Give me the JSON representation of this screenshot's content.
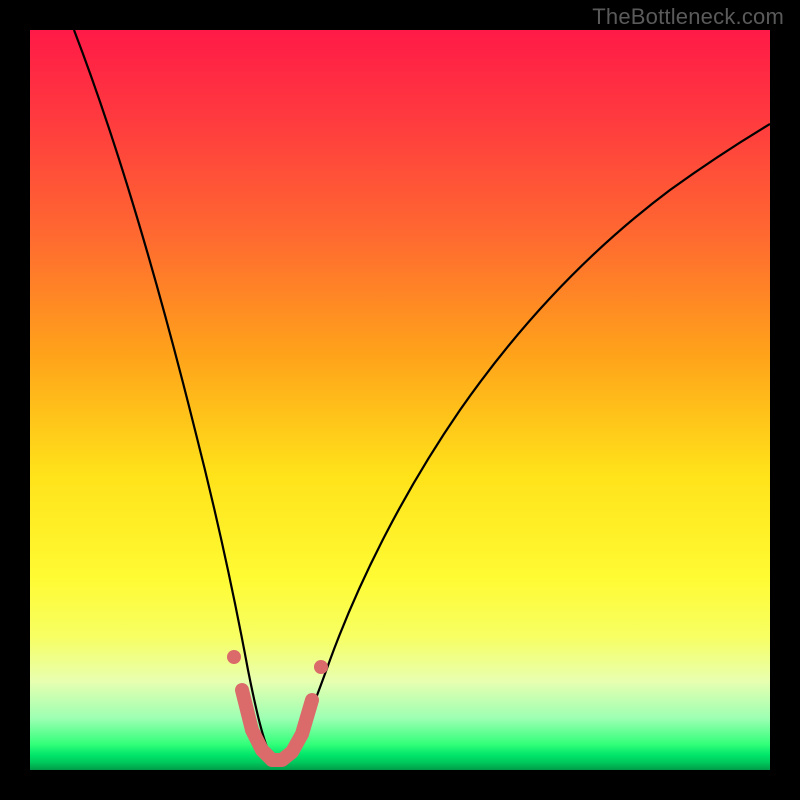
{
  "watermark": "TheBottleneck.com",
  "colors": {
    "frame": "#000000",
    "curve": "#000000",
    "marker": "#db6b6b",
    "gradient_top": "#ff1a47",
    "gradient_bottom": "#009a47"
  },
  "chart_data": {
    "type": "line",
    "title": "",
    "xlabel": "",
    "ylabel": "",
    "xlim": [
      0,
      100
    ],
    "ylim": [
      0,
      100
    ],
    "grid": false,
    "series": [
      {
        "name": "bottleneck-curve",
        "x": [
          6,
          10,
          14,
          18,
          22,
          25,
          27,
          29,
          30,
          31,
          32,
          33,
          34,
          35,
          37,
          40,
          44,
          50,
          58,
          68,
          80,
          92,
          100
        ],
        "values": [
          100,
          87,
          73,
          58,
          42,
          28,
          19,
          11,
          7,
          4,
          2,
          1,
          1,
          2,
          4,
          9,
          17,
          28,
          42,
          56,
          68,
          77,
          82
        ]
      }
    ],
    "highlight_segment": {
      "note": "thick salmon polyline tracing the valley floor",
      "x": [
        28.5,
        30,
        31,
        32,
        33,
        34,
        35,
        36.5
      ],
      "values": [
        12,
        6,
        3,
        1.5,
        1.5,
        2.5,
        4.5,
        10
      ]
    },
    "highlight_dots": [
      {
        "x": 27.3,
        "y": 17
      },
      {
        "x": 37.8,
        "y": 15
      }
    ]
  }
}
